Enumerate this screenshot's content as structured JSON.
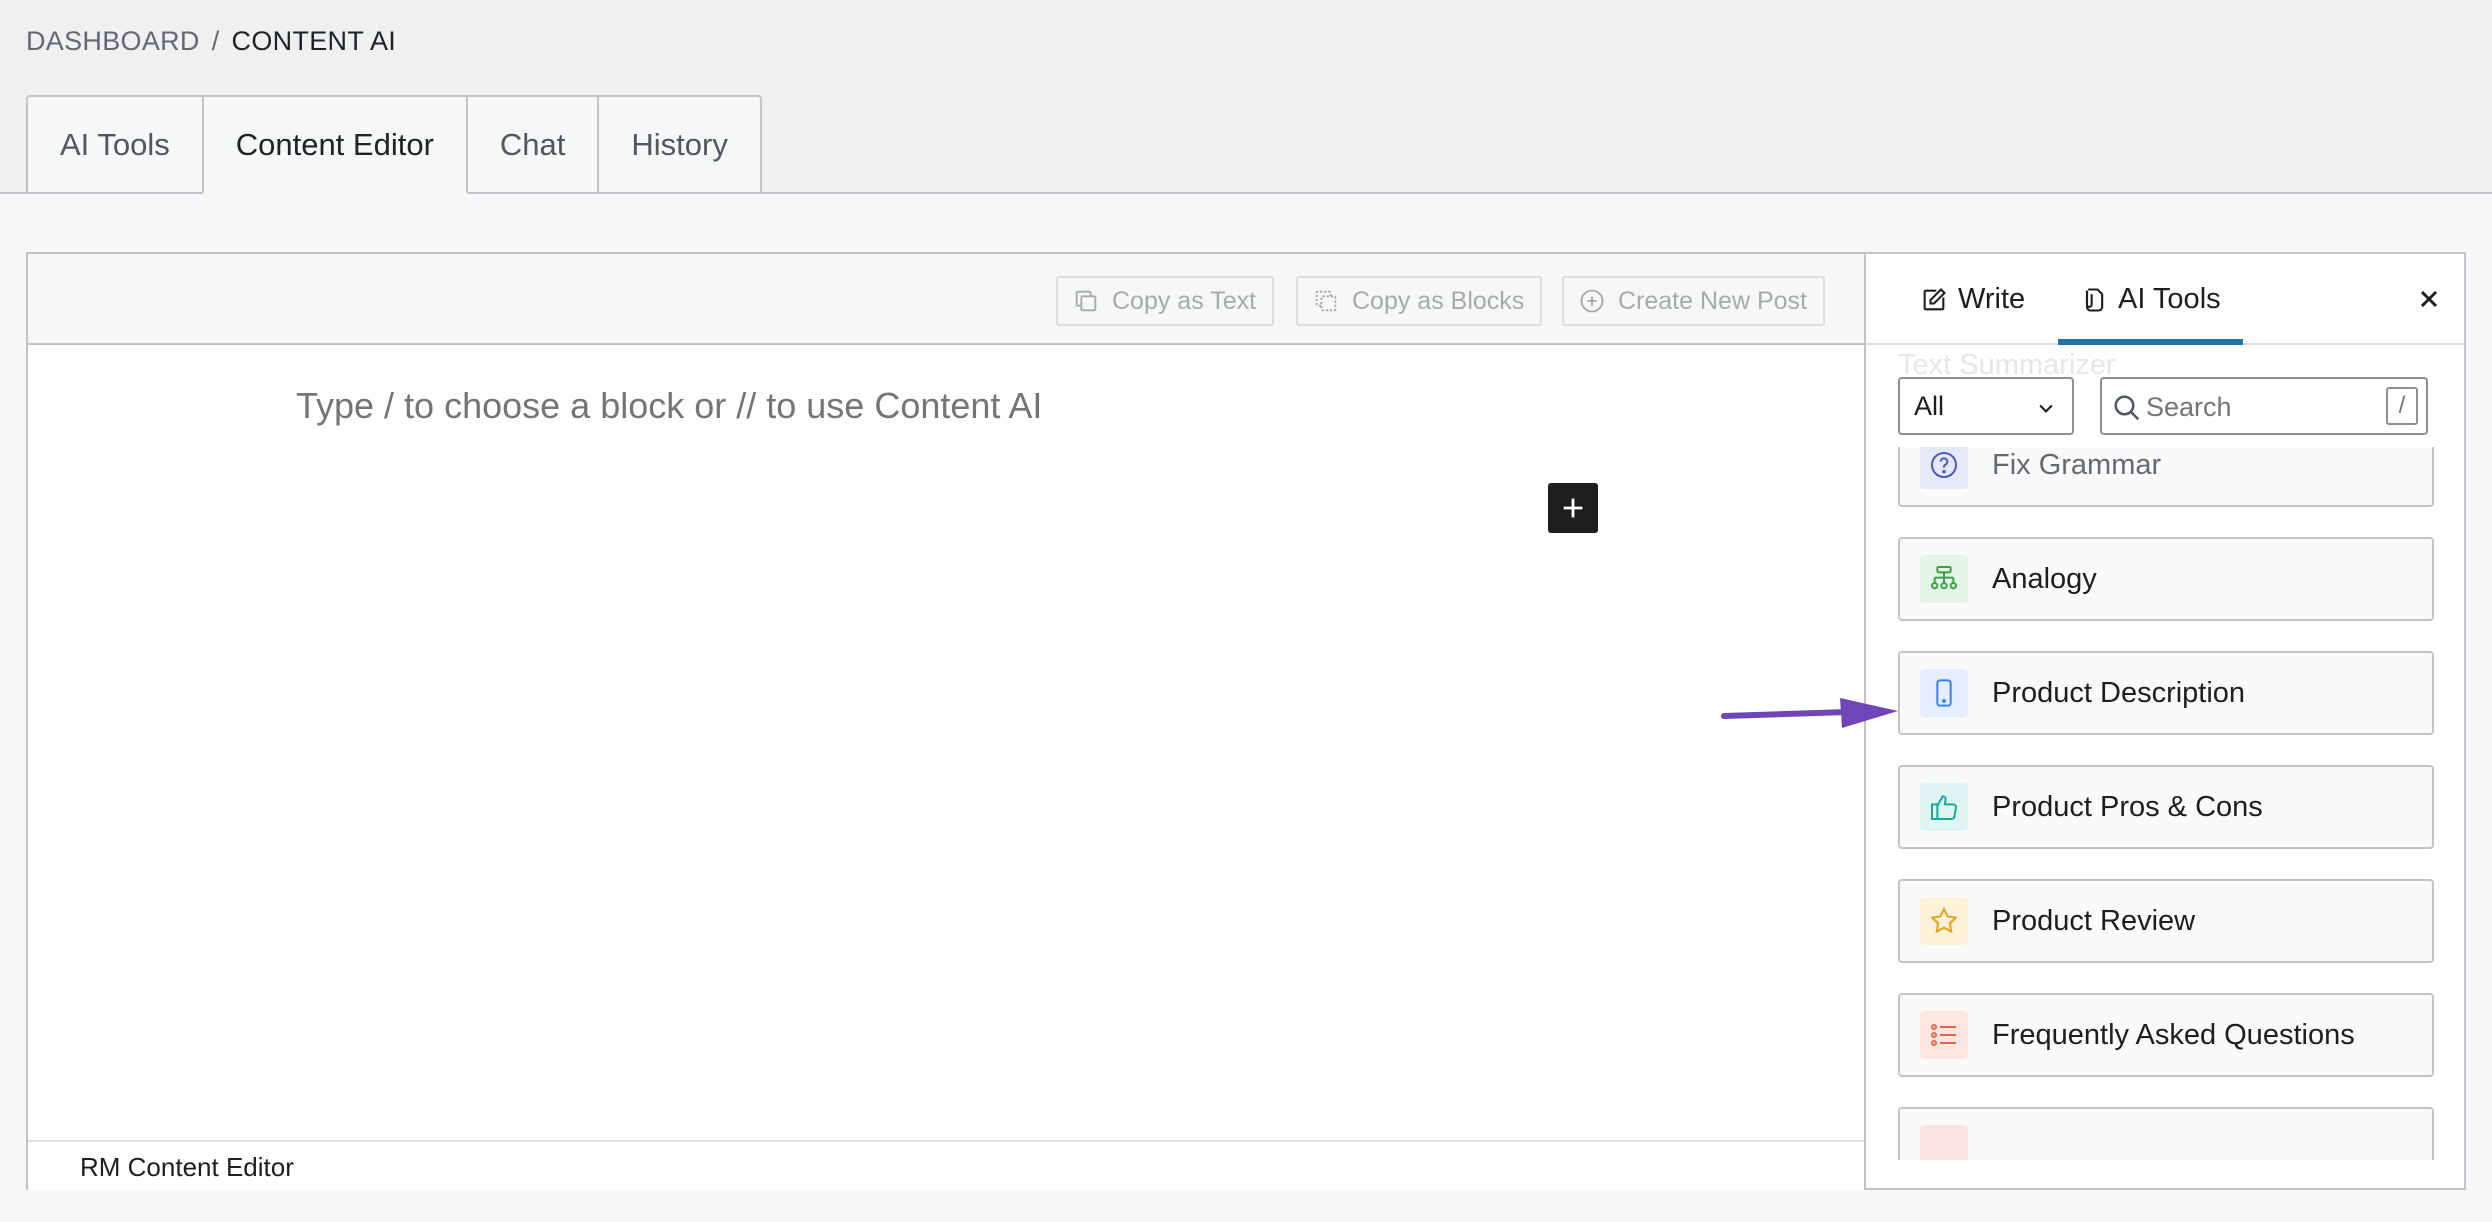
{
  "breadcrumb": {
    "parent": "DASHBOARD",
    "separator": "/",
    "current": "CONTENT AI"
  },
  "main_tabs": [
    {
      "label": "AI Tools",
      "active": false
    },
    {
      "label": "Content Editor",
      "active": true
    },
    {
      "label": "Chat",
      "active": false
    },
    {
      "label": "History",
      "active": false
    }
  ],
  "toolbar": {
    "copy_text": "Copy as Text",
    "copy_blocks": "Copy as Blocks",
    "create_post": "Create New Post"
  },
  "editor": {
    "placeholder": "Type / to choose a block or // to use Content AI",
    "footer_label": "RM Content Editor"
  },
  "sidebar": {
    "tabs": [
      {
        "label": "Write",
        "icon": "edit-icon",
        "active": false
      },
      {
        "label": "AI Tools",
        "icon": "document-icon",
        "active": true
      }
    ],
    "ghost_item": "Text Summarizer",
    "filter": {
      "selected": "All"
    },
    "search": {
      "placeholder": "Search",
      "shortcut": "/"
    },
    "tools": [
      {
        "label": "Fix Grammar",
        "icon": "question-icon",
        "color": "#4e5bb8",
        "bg": "#e6e8f5"
      },
      {
        "label": "Analogy",
        "icon": "hierarchy-icon",
        "color": "#3aa34a",
        "bg": "#e4f4e6"
      },
      {
        "label": "Product Description",
        "icon": "phone-icon",
        "color": "#3b82f6",
        "bg": "#e3edfd"
      },
      {
        "label": "Product Pros & Cons",
        "icon": "thumbs-up-icon",
        "color": "#1aa89a",
        "bg": "#dff5f1"
      },
      {
        "label": "Product Review",
        "icon": "star-icon",
        "color": "#e0a31a",
        "bg": "#fcf1d9"
      },
      {
        "label": "Frequently Asked Questions",
        "icon": "list-icon",
        "color": "#e5674a",
        "bg": "#fde6df"
      }
    ],
    "annotation_color": "#6e46b8"
  }
}
